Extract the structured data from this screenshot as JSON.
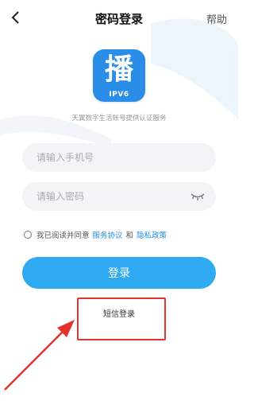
{
  "header": {
    "title": "密码登录",
    "help_label": "帮助"
  },
  "logo": {
    "char": "播",
    "sub": "IPV6"
  },
  "tagline": "天翼数字生活账号提供认证服务",
  "form": {
    "phone_placeholder": "请输入手机号",
    "password_placeholder": "请输入密码"
  },
  "agreement": {
    "prefix": "我已阅读并同意",
    "service_link": "服务协议",
    "and": "和",
    "privacy_link": "隐私政策"
  },
  "login_button": "登录",
  "sms_login": "短信登录",
  "colors": {
    "accent": "#2ea9f2",
    "link": "#1e90e8",
    "logo_bg": "#2a8ee8",
    "annotation": "#e3322f"
  }
}
